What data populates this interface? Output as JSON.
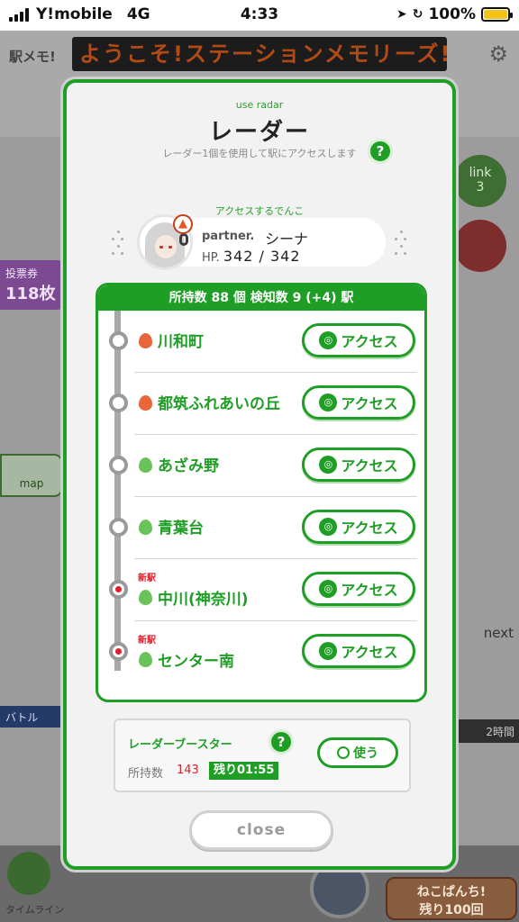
{
  "status_bar": {
    "carrier": "Y!mobile",
    "network": "4G",
    "time": "4:33",
    "battery": "100%",
    "battery_level": 1.0
  },
  "background": {
    "app_logo": "駅メモ!",
    "ticker": "ようこそ!ステーションメモリーズ!",
    "vote_label": "投票券",
    "vote_count": "118枚",
    "link_label": "link",
    "link_count": "3",
    "map_label": "map",
    "next_label": "next",
    "battle_label": "バトル",
    "time_label": "2時間",
    "neko_line1": "ねこぱんち!",
    "neko_line2": "残り100回",
    "timeline_label": "タイムライン"
  },
  "modal": {
    "subtitle": "use radar",
    "title": "レーダー",
    "description": "レーダー1個を使用して駅にアクセスします",
    "help": "?",
    "partner_heading": "アクセスするでんこ",
    "partner_label": "partner.",
    "partner_name": "シーナ",
    "hp_label": "HP.",
    "hp_value": "342 / 342",
    "station_summary": "所持数 88 個 検知数 9 (+4) 駅",
    "access_label": "アクセス",
    "new_label": "新駅",
    "stations": [
      {
        "name": "川和町",
        "icon": "fire-icon",
        "is_new": false
      },
      {
        "name": "都筑ふれあいの丘",
        "icon": "fire-icon",
        "is_new": false
      },
      {
        "name": "あざみ野",
        "icon": "leaf-icon",
        "is_new": false
      },
      {
        "name": "青葉台",
        "icon": "leaf-icon",
        "is_new": false
      },
      {
        "name": "中川(神奈川)",
        "icon": "leaf-icon",
        "is_new": true
      },
      {
        "name": "センター南",
        "icon": "leaf-icon",
        "is_new": true
      }
    ],
    "booster": {
      "title": "レーダーブースター",
      "owned_label": "所持数",
      "owned_count": "143",
      "remaining": "残り01:55",
      "use_label": "使う"
    },
    "close_label": "close"
  },
  "colors": {
    "accent": "#1f9e25",
    "new_red": "#e01f2a",
    "fire": "#e8663a",
    "leaf": "#6cc25a"
  }
}
